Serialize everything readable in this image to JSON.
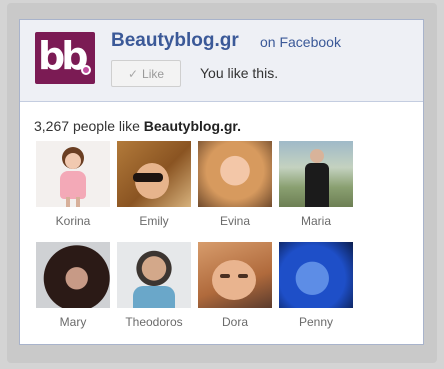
{
  "header": {
    "logo_text": "bb",
    "page_name": "Beautyblog.gr",
    "on_facebook": "on Facebook",
    "like_button_label": "Like",
    "you_like_text": "You like this."
  },
  "stats": {
    "count": "3,267",
    "people_like_text": "people like",
    "page_name": "Beautyblog.gr."
  },
  "people": [
    {
      "name": "Korina"
    },
    {
      "name": "Emily"
    },
    {
      "name": "Evina"
    },
    {
      "name": "Maria"
    },
    {
      "name": "Mary"
    },
    {
      "name": "Theodoros"
    },
    {
      "name": "Dora"
    },
    {
      "name": "Penny"
    }
  ],
  "colors": {
    "facebook_blue": "#3b5998",
    "logo_background": "#7b1b54",
    "header_background": "#eef0f5"
  }
}
